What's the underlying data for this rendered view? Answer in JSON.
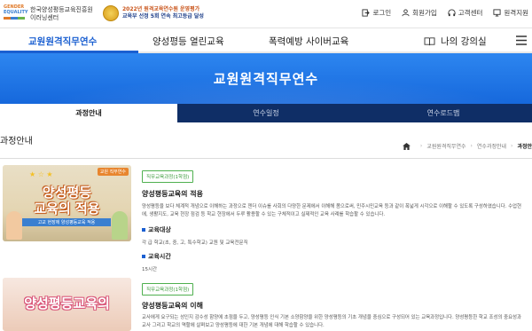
{
  "header": {
    "logo_line1": "GENDER",
    "logo_line2": "EQUALITY",
    "org_line1": "한국양성평등교육진흥원",
    "org_line2": "이러닝센터",
    "award_line1": "2022년 원격교육연수원 운영평가",
    "award_line2": "교육부 선정 5회 연속 최고등급 달성",
    "utility": [
      {
        "label": "로그인",
        "icon": "login-icon"
      },
      {
        "label": "회원가입",
        "icon": "user-icon"
      },
      {
        "label": "고객센터",
        "icon": "headset-icon"
      },
      {
        "label": "원격지원",
        "icon": "monitor-icon"
      }
    ]
  },
  "nav": {
    "items": [
      {
        "label": "교원원격직무연수",
        "active": true
      },
      {
        "label": "양성평등 열린교육",
        "active": false
      },
      {
        "label": "폭력예방 사이버교육",
        "active": false
      }
    ],
    "lecture": "나의 강의실",
    "lecture_icon": "book-icon",
    "menu_icon": "hamburger-icon"
  },
  "hero": {
    "title": "교원원격직무연수"
  },
  "tabs": [
    {
      "label": "과정안내",
      "active": true
    },
    {
      "label": "연수일정",
      "active": false
    },
    {
      "label": "연수로드맵",
      "active": false
    }
  ],
  "section": {
    "title": "과정안내",
    "breadcrumb": [
      "교원원격직무연수",
      "연수과정안내",
      "과정안"
    ],
    "home_icon": "home-icon"
  },
  "courses": [
    {
      "badge": "직무교육과정(1학점)",
      "title": "양성평등교육의 적용",
      "desc": "양성평등을 보다 체계적 개념으로 이해하는 과정으로 젠더 이슈를 사회의 다양한 문제에서 이해해 봄으로써, 민주시민교육 등과 같이 폭넓게 시각으로 이해할 수 있도록 구성하였습니다. 수업현에, 생활지도, 교육 현장 점검 등 학교 현장에서 두루 활용할 수 있는 구체적이고 실제적인 교육 사례를 학습할 수 있습니다.",
      "target_label": "교육대상",
      "target_value": "각 급 학교(초, 중, 고, 특수학교) 교원 및 교육전문직",
      "hours_label": "교육시간",
      "hours_value": "15시간",
      "thumb": {
        "line1": "양성평등",
        "line2": "교육의 적용",
        "ribbon": "교원 직무연수",
        "sub": "고교 현장에 양성평등교육 적용"
      }
    },
    {
      "badge": "직무교육과정(1학점)",
      "title": "양성평등교육의 이해",
      "desc": "교사에게 요구되는 성인지 감수성 함양에 초점을 두고, 양성평등 인식 기본 소양함양을 위한 양성평등의 기초 개념을 중심으로 구성되어 있는 교육과정입니다. 양성평등한 학교 조성의 중요성과 교사 그리고 학교의 역할에 살펴보고 양성평등에 대한 기본 개념에 대해 학습할 수 있습니다.",
      "thumb": {
        "line1": "양성평등교육의"
      }
    }
  ],
  "colors": {
    "accent": "#1a5fd1",
    "tabbar": "#0f2e66",
    "badge": "#4fb04f"
  }
}
